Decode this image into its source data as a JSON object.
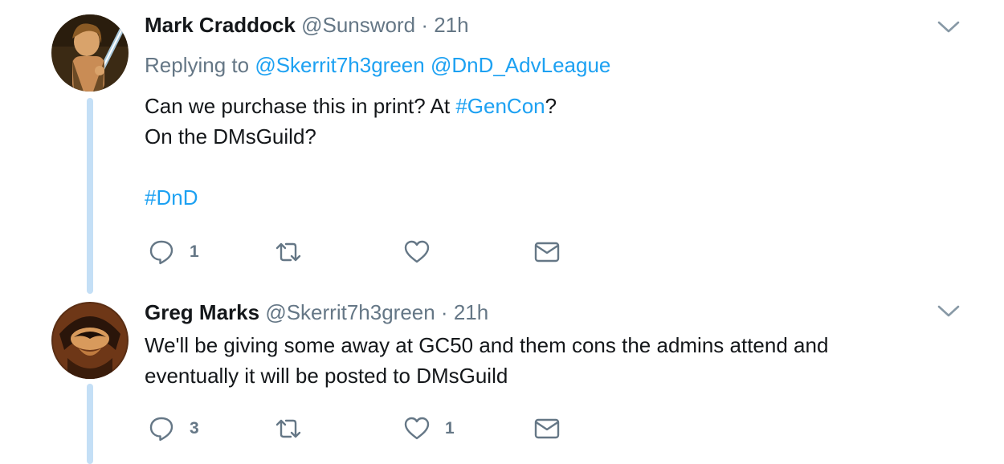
{
  "tweets": [
    {
      "name": "Mark Craddock",
      "handle": "@Sunsword",
      "sep": " · ",
      "time": "21h",
      "replying_prefix": "Replying to ",
      "replying_to": [
        "@Skerrit7h3green",
        "@DnD_AdvLeague"
      ],
      "text": {
        "l1_a": "Can we purchase this in print? At ",
        "l1_tag": "#GenCon",
        "l1_b": "?",
        "l2": "On the DMsGuild?",
        "l4_tag": "#DnD"
      },
      "icons": {
        "reply": "reply-icon",
        "retweet": "retweet-icon",
        "like": "heart-icon",
        "dm": "envelope-icon",
        "menu": "chevron-down-icon"
      },
      "reply_count": "1",
      "retweet_count": "",
      "like_count": ""
    },
    {
      "name": "Greg Marks",
      "handle": "@Skerrit7h3green",
      "sep": " · ",
      "time": "21h",
      "text": {
        "l1": "We'll be giving some away at GC50 and them cons the admins attend and",
        "l2": "eventually it will be posted to DMsGuild"
      },
      "icons": {
        "reply": "reply-icon",
        "retweet": "retweet-icon",
        "like": "heart-icon",
        "dm": "envelope-icon",
        "menu": "chevron-down-icon"
      },
      "reply_count": "3",
      "retweet_count": "",
      "like_count": "1"
    }
  ],
  "colors": {
    "link": "#1da1f2",
    "meta": "#657786",
    "thread_line": "#c4dff6",
    "text": "#14171a"
  }
}
